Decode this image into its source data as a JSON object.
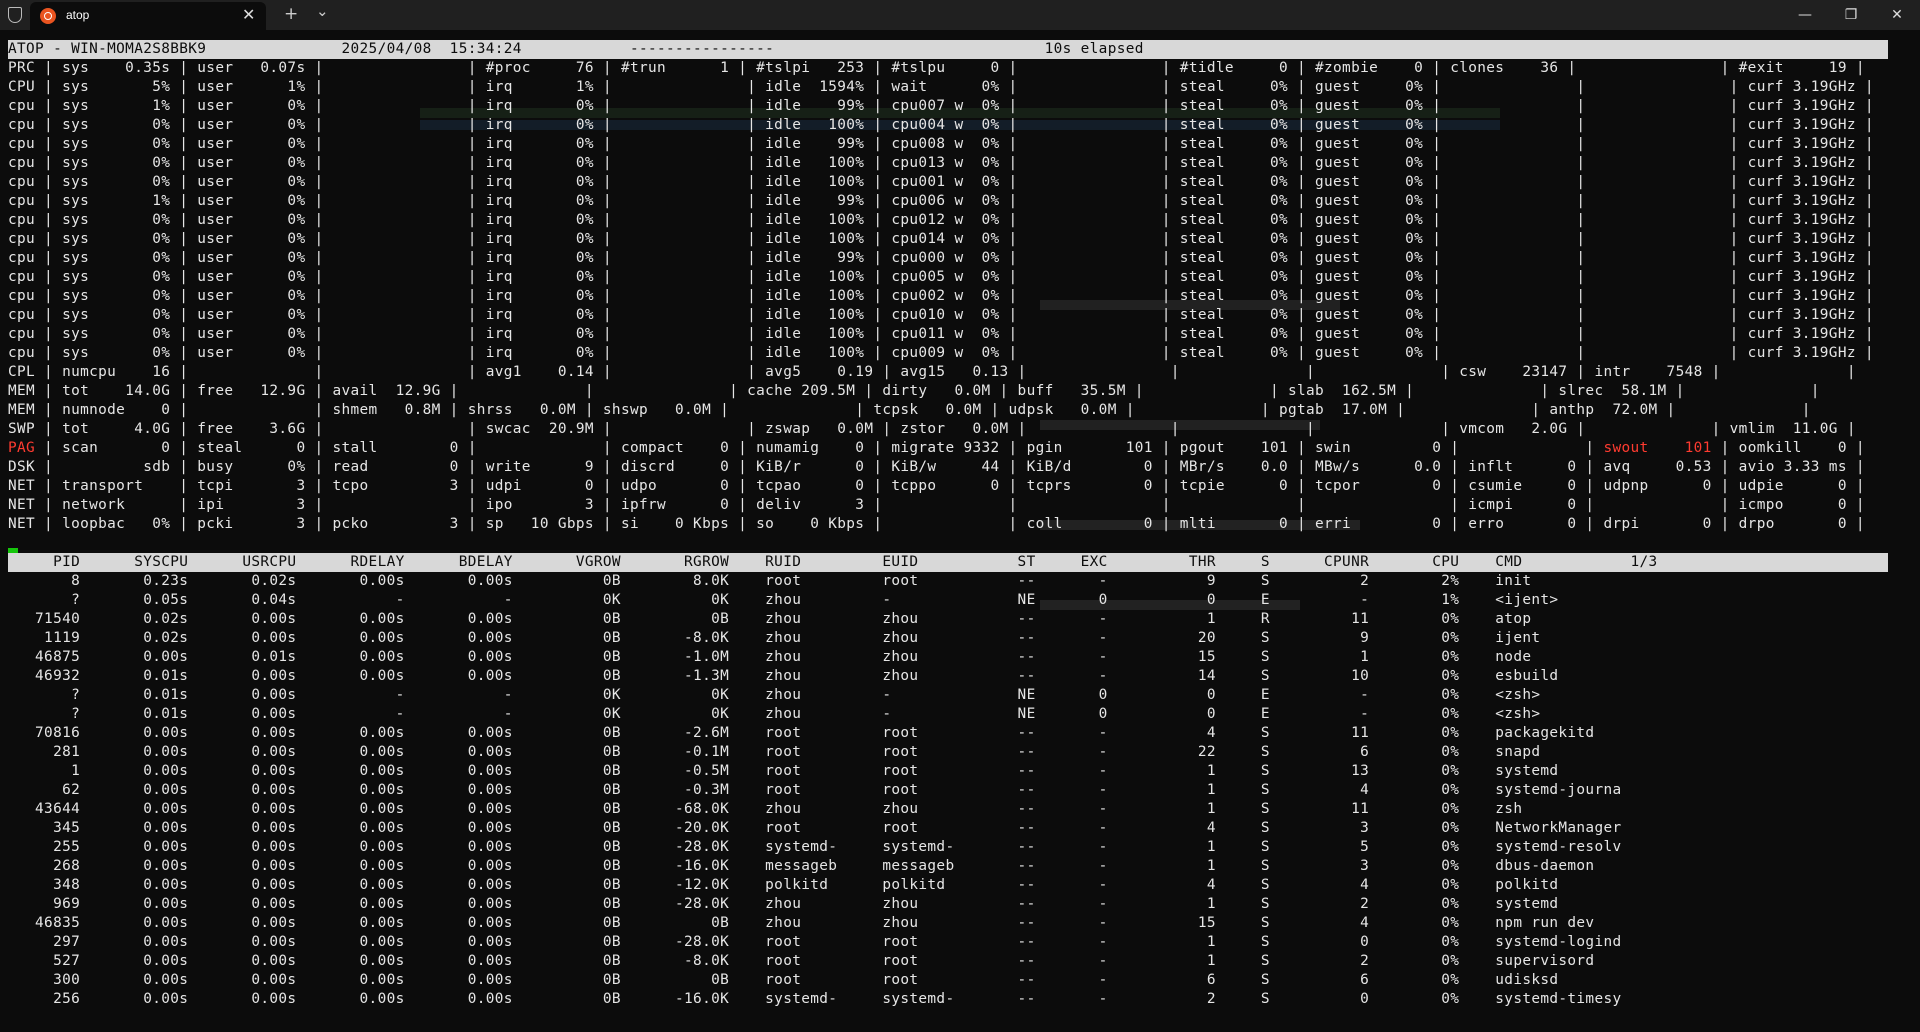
{
  "window": {
    "tab_title": "atop",
    "new_tab_symbol": "+",
    "dropdown_symbol": "⌄",
    "close_tab_symbol": "✕",
    "minimize_symbol": "—",
    "restore_symbol": "❐",
    "close_symbol": "✕"
  },
  "atop": {
    "header": "ATOP - WIN-MOMA2S8BBK9               2025/04/08  15:34:24            ----------------                              10s elapsed",
    "system_lines": [
      {
        "prefix": "",
        "text": "PRC | sys    0.35s | user   0.07s |                | #proc     76 | #trun      1 | #tslpi   253 | #tslpu     0 |                | #tidle     0 | #zombie    0 | clones    36 |                | #exit     19 |"
      },
      {
        "prefix": "",
        "text": "CPU | sys       5% | user      1% |                | irq       1% |               | idle  1594% | wait      0% |                | steal     0% | guest     0% |               |                | curf 3.19GHz |"
      },
      {
        "prefix": "",
        "text": "cpu | sys       1% | user      0% |                | irq       0% |               | idle    99% | cpu007 w  0% |                | steal     0% | guest     0% |               |                | curf 3.19GHz |"
      },
      {
        "prefix": "",
        "text": "cpu | sys       0% | user      0% |                | irq       0% |               | idle   100% | cpu004 w  0% |                | steal     0% | guest     0% |               |                | curf 3.19GHz |"
      },
      {
        "prefix": "",
        "text": "cpu | sys       0% | user      0% |                | irq       0% |               | idle    99% | cpu008 w  0% |                | steal     0% | guest     0% |               |                | curf 3.19GHz |"
      },
      {
        "prefix": "",
        "text": "cpu | sys       0% | user      0% |                | irq       0% |               | idle   100% | cpu013 w  0% |                | steal     0% | guest     0% |               |                | curf 3.19GHz |"
      },
      {
        "prefix": "",
        "text": "cpu | sys       0% | user      0% |                | irq       0% |               | idle   100% | cpu001 w  0% |                | steal     0% | guest     0% |               |                | curf 3.19GHz |"
      },
      {
        "prefix": "",
        "text": "cpu | sys       1% | user      0% |                | irq       0% |               | idle    99% | cpu006 w  0% |                | steal     0% | guest     0% |               |                | curf 3.19GHz |"
      },
      {
        "prefix": "",
        "text": "cpu | sys       0% | user      0% |                | irq       0% |               | idle   100% | cpu012 w  0% |                | steal     0% | guest     0% |               |                | curf 3.19GHz |"
      },
      {
        "prefix": "",
        "text": "cpu | sys       0% | user      0% |                | irq       0% |               | idle   100% | cpu014 w  0% |                | steal     0% | guest     0% |               |                | curf 3.19GHz |"
      },
      {
        "prefix": "",
        "text": "cpu | sys       0% | user      0% |                | irq       0% |               | idle    99% | cpu000 w  0% |                | steal     0% | guest     0% |               |                | curf 3.19GHz |"
      },
      {
        "prefix": "",
        "text": "cpu | sys       0% | user      0% |                | irq       0% |               | idle   100% | cpu005 w  0% |                | steal     0% | guest     0% |               |                | curf 3.19GHz |"
      },
      {
        "prefix": "",
        "text": "cpu | sys       0% | user      0% |                | irq       0% |               | idle   100% | cpu002 w  0% |                | steal     0% | guest     0% |               |                | curf 3.19GHz |"
      },
      {
        "prefix": "",
        "text": "cpu | sys       0% | user      0% |                | irq       0% |               | idle   100% | cpu010 w  0% |                | steal     0% | guest     0% |               |                | curf 3.19GHz |"
      },
      {
        "prefix": "",
        "text": "cpu | sys       0% | user      0% |                | irq       0% |               | idle   100% | cpu011 w  0% |                | steal     0% | guest     0% |               |                | curf 3.19GHz |"
      },
      {
        "prefix": "",
        "text": "cpu | sys       0% | user      0% |                | irq       0% |               | idle   100% | cpu009 w  0% |                | steal     0% | guest     0% |               |                | curf 3.19GHz |"
      },
      {
        "prefix": "",
        "text": "CPL | numcpu    16 |              |                | avg1    0.14 |               | avg5    0.19 | avg15   0.13 |                |              |              | csw    23147 | intr    7548 |              |"
      },
      {
        "prefix": "",
        "text": "MEM | tot    14.0G | free   12.9G | avail  12.9G |              |               | cache 209.5M | dirty   0.0M | buff   35.5M |              | slab  162.5M |              | slrec  58.1M |              |"
      },
      {
        "prefix": "",
        "text": "MEM | numnode    0 |              | shmem   0.8M | shrss   0.0M | shswp   0.0M |              | tcpsk   0.0M | udpsk   0.0M |              | pgtab  17.0M |              | anthp  72.0M |              |"
      },
      {
        "prefix": "",
        "text": "SWP | tot     4.0G | free    3.6G |                | swcac  20.9M |               | zswap   0.0M | zstor   0.0M |                |              |              | vmcom   2.0G |              | vmlim  11.0G |"
      },
      {
        "prefix": "PAG",
        "text": " | scan       0 | steal      0 | stall        0 |              | compact    0 | numamig    0 | migrate 9332 | pgin       101 | pgout    101 | swin         0 |              | swout    101 | oomkill    0 |"
      },
      {
        "prefix": "",
        "text": "DSK |          sdb | busy      0% | read         0 | write      9 | discrd     0 | KiB/r      0 | KiB/w     44 | KiB/d        0 | MBr/s    0.0 | MBw/s      0.0 | inflt      0 | avq     0.53 | avio 3.33 ms |"
      },
      {
        "prefix": "",
        "text": "NET | transport    | tcpi       3 | tcpo         3 | udpi       0 | udpo       0 | tcpao      0 | tcppo      0 | tcprs        0 | tcpie      0 | tcpor        0 | csumie     0 | udpnp      0 | udpie      0 |"
      },
      {
        "prefix": "",
        "text": "NET | network      | ipi        3 |                | ipo        3 | ipfrw      0 | deliv      3 |              |                |              |                | icmpi      0 |              | icmpo      0 |"
      },
      {
        "prefix": "",
        "text": "NET | loopbac   0% | pcki       3 | pcko         3 | sp   10 Gbps | si    0 Kbps | so    0 Kbps |              | coll         0 | mlti       0 | erri         0 | erro       0 | drpi       0 | drpo       0 |"
      }
    ],
    "process_header": "     PID      SYSCPU      USRCPU      RDELAY      BDELAY       VGROW       RGROW    RUID         EUID           ST     EXC         THR     S      CPUNR       CPU    CMD            1/3",
    "processes": [
      "       8       0.23s       0.02s       0.00s       0.00s          0B        8.0K    root         root           --       -           9     S          2        2%    init",
      "       ?       0.05s       0.04s           -           -          0K          0K    zhou         -              NE       0           0     E          -        1%    <ijent>",
      "   71540       0.02s       0.00s       0.00s       0.00s          0B          0B    zhou         zhou           --       -           1     R         11        0%    atop",
      "    1119       0.02s       0.00s       0.00s       0.00s          0B       -8.0K    zhou         zhou           --       -          20     S          9        0%    ijent",
      "   46875       0.00s       0.01s       0.00s       0.00s          0B       -1.0M    zhou         zhou           --       -          15     S          1        0%    node",
      "   46932       0.01s       0.00s       0.00s       0.00s          0B       -1.3M    zhou         zhou           --       -          14     S         10        0%    esbuild",
      "       ?       0.01s       0.00s           -           -          0K          0K    zhou         -              NE       0           0     E          -        0%    <zsh>",
      "       ?       0.01s       0.00s           -           -          0K          0K    zhou         -              NE       0           0     E          -        0%    <zsh>",
      "   70816       0.00s       0.00s       0.00s       0.00s          0B       -2.6M    root         root           --       -           4     S         11        0%    packagekitd",
      "     281       0.00s       0.00s       0.00s       0.00s          0B       -0.1M    root         root           --       -          22     S          6        0%    snapd",
      "       1       0.00s       0.00s       0.00s       0.00s          0B       -0.5M    root         root           --       -           1     S         13        0%    systemd",
      "      62       0.00s       0.00s       0.00s       0.00s          0B       -0.3M    root         root           --       -           1     S          4        0%    systemd-journa",
      "   43644       0.00s       0.00s       0.00s       0.00s          0B      -68.0K    zhou         zhou           --       -           1     S         11        0%    zsh",
      "     345       0.00s       0.00s       0.00s       0.00s          0B      -20.0K    root         root           --       -           4     S          3        0%    NetworkManager",
      "     255       0.00s       0.00s       0.00s       0.00s          0B      -28.0K    systemd-     systemd-       --       -           1     S          5        0%    systemd-resolv",
      "     268       0.00s       0.00s       0.00s       0.00s          0B      -16.0K    messageb     messageb       --       -           1     S          3        0%    dbus-daemon",
      "     348       0.00s       0.00s       0.00s       0.00s          0B      -12.0K    polkitd      polkitd        --       -           4     S          4        0%    polkitd",
      "     969       0.00s       0.00s       0.00s       0.00s          0B      -28.0K    zhou         zhou           --       -           1     S          2        0%    systemd",
      "   46835       0.00s       0.00s       0.00s       0.00s          0B          0B    zhou         zhou           --       -          15     S          4        0%    npm run dev",
      "     297       0.00s       0.00s       0.00s       0.00s          0B      -28.0K    root         root           --       -           1     S          0        0%    systemd-logind",
      "     527       0.00s       0.00s       0.00s       0.00s          0B       -8.0K    root         root           --       -           1     S          2        0%    supervisord",
      "     300       0.00s       0.00s       0.00s       0.00s          0B          0B    root         root           --       -           6     S          6        0%    udisksd",
      "     256       0.00s       0.00s       0.00s       0.00s          0B      -16.0K    systemd-     systemd-       --       -           2     S          0        0%    systemd-timesy"
    ]
  },
  "colors": {
    "background": "#0c0c0c",
    "text": "#e6e6e6",
    "header_bar": "#d8d8d8",
    "alert_red": "#ff3b30",
    "accent_green": "#16c60c",
    "tab_icon": "#e95420"
  },
  "icons": {
    "tab_app": "ubuntu-icon",
    "shield": "shield-icon"
  }
}
